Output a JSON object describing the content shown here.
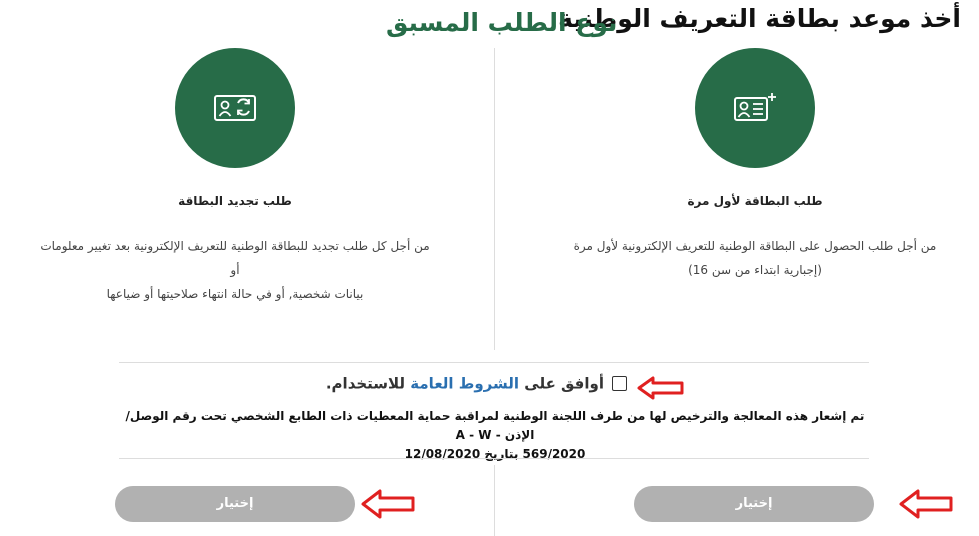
{
  "header": {
    "title": "أخذ موعد بطاقة التعريف الوطنية",
    "section_title": "نوع الطلب المسبق"
  },
  "cards": [
    {
      "icon": "id-card-add-icon",
      "title": "طلب البطاقة لأول مرة",
      "desc_line1": "من أجل طلب الحصول على البطاقة الوطنية للتعريف الإلكترونية لأول مرة",
      "desc_line2": "(إجبارية ابتداء من سن 16)",
      "button_label": "إختيار"
    },
    {
      "icon": "id-card-renew-icon",
      "title": "طلب تجديد البطاقة",
      "desc_line1": "من أجل كل طلب تجديد للبطاقة الوطنية للتعريف الإلكترونية بعد تغيير معلومات أو",
      "desc_line2": "بيانات شخصية, أو في حالة انتهاء صلاحيتها أو ضياعها",
      "button_label": "إختيار"
    }
  ],
  "terms": {
    "prefix": "أوافق على ",
    "link": "الشروط العامة",
    "suffix": " للاستخدام."
  },
  "notice": {
    "line1": "تم إشعار هذه المعالجة والترخيص لها من طرف اللجنة الوطنية لمراقبة حماية المعطيات ذات الطابع الشخصي تحت رقم الوصل/الإذن - A - W",
    "line2": "569/2020 بتاريخ 12/08/2020"
  },
  "colors": {
    "brand_green": "#276c48",
    "button_gray": "#b1b1b1",
    "link_blue": "#2a6fb0",
    "annotation_red": "#e02020"
  }
}
